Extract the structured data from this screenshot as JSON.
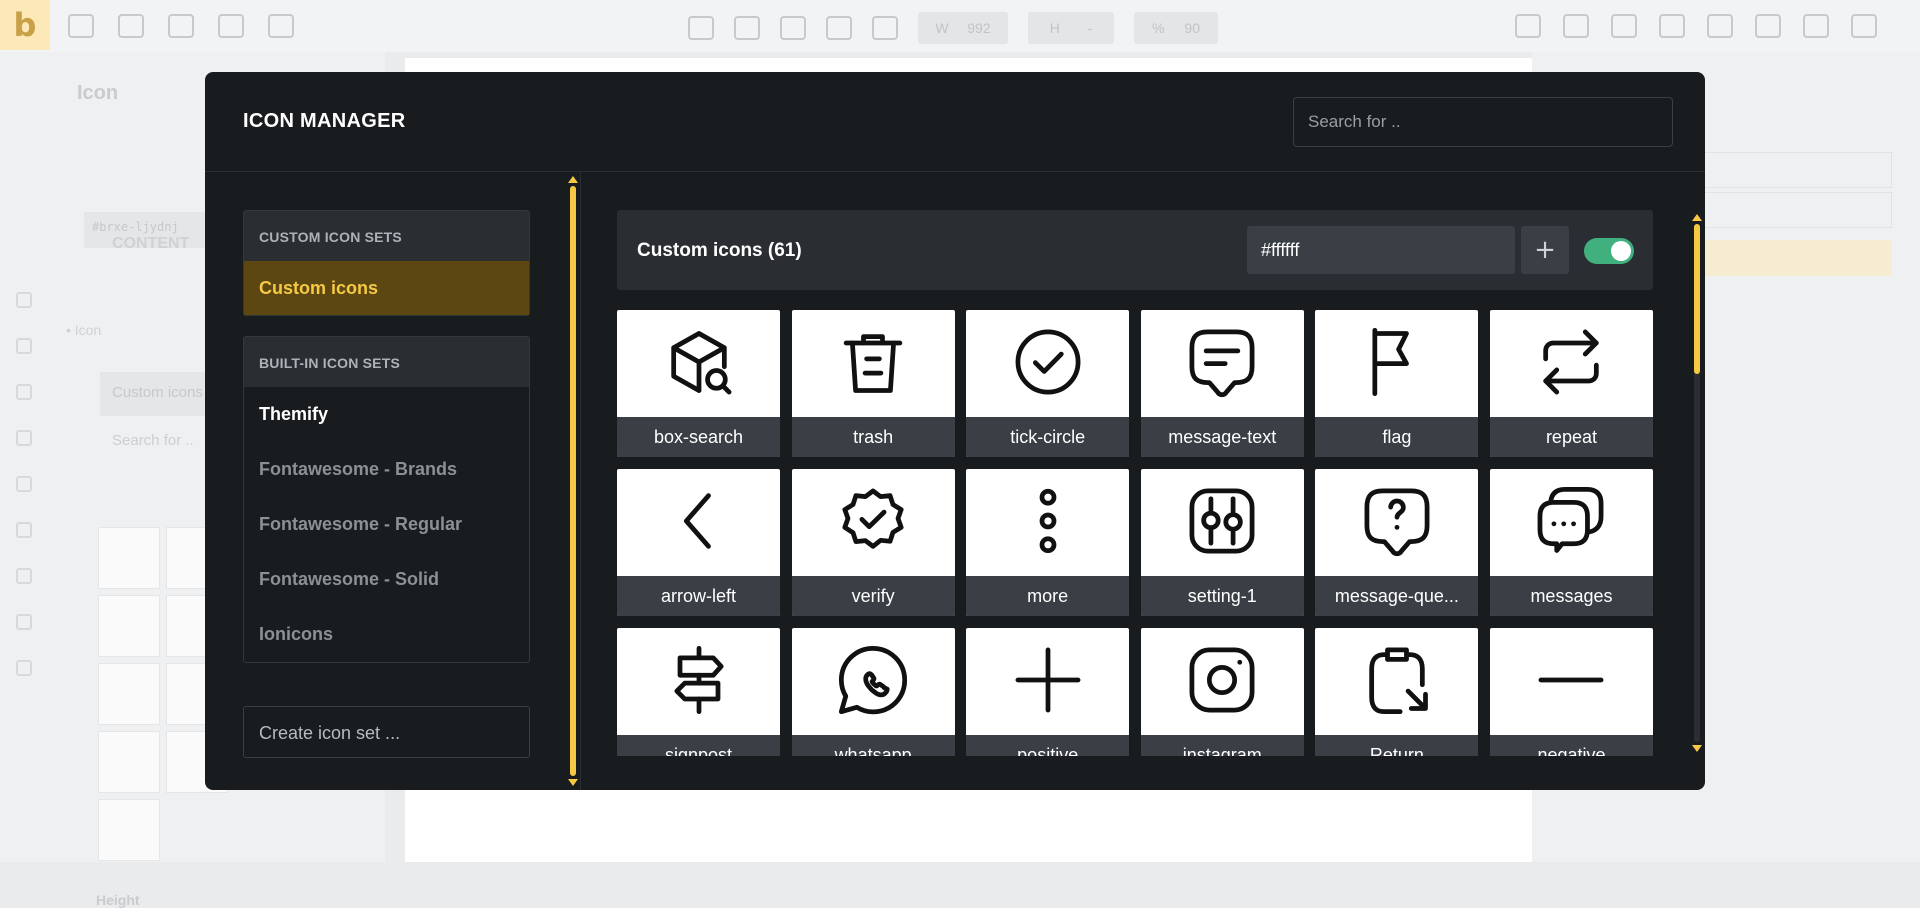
{
  "background": {
    "logo": "b",
    "toolbar": {
      "w_label": "W",
      "w_value": "992",
      "h_label": "H",
      "h_value": "-",
      "pct_label": "%",
      "pct_value": "90"
    },
    "left_panel": {
      "title": "Icon",
      "css_id": "#brxe-ljydnj",
      "content_label": "CONTENT",
      "icon_label": "Icon",
      "custom_icons": "Custom icons",
      "search": "Search for ..",
      "height_label": "Height"
    }
  },
  "modal": {
    "title": "ICON MANAGER",
    "search_placeholder": "Search for ..",
    "sidebar": {
      "custom_header": "CUSTOM ICON SETS",
      "custom_items": [
        {
          "label": "Custom icons"
        }
      ],
      "builtin_header": "BUILT-IN ICON SETS",
      "builtin_items": [
        {
          "label": "Themify"
        },
        {
          "label": "Fontawesome - Brands"
        },
        {
          "label": "Fontawesome - Regular"
        },
        {
          "label": "Fontawesome - Solid"
        },
        {
          "label": "Ionicons"
        }
      ],
      "create_placeholder": "Create icon set ..."
    },
    "icon_set": {
      "title": "Custom icons (61)",
      "color_value": "#ffffff",
      "add_label": "+",
      "toggle_on": true,
      "accent_color": "#f5c944",
      "toggle_color": "#40b07f"
    },
    "icons": [
      {
        "label": "box-search",
        "icon": "box-search-icon"
      },
      {
        "label": "trash",
        "icon": "trash-icon"
      },
      {
        "label": "tick-circle",
        "icon": "tick-circle-icon"
      },
      {
        "label": "message-text",
        "icon": "message-text-icon"
      },
      {
        "label": "flag",
        "icon": "flag-icon"
      },
      {
        "label": "repeat",
        "icon": "repeat-icon"
      },
      {
        "label": "arrow-left",
        "icon": "arrow-left-icon"
      },
      {
        "label": "verify",
        "icon": "verify-icon"
      },
      {
        "label": "more",
        "icon": "more-icon"
      },
      {
        "label": "setting-1",
        "icon": "setting-icon"
      },
      {
        "label": "message-que...",
        "icon": "message-question-icon"
      },
      {
        "label": "messages",
        "icon": "messages-icon"
      },
      {
        "label": "signpost",
        "icon": "signpost-icon"
      },
      {
        "label": "whatsapp",
        "icon": "whatsapp-icon"
      },
      {
        "label": "positive",
        "icon": "plus-icon"
      },
      {
        "label": "instagram",
        "icon": "instagram-icon"
      },
      {
        "label": "Return",
        "icon": "return-icon"
      },
      {
        "label": "negative",
        "icon": "minus-icon"
      }
    ]
  }
}
